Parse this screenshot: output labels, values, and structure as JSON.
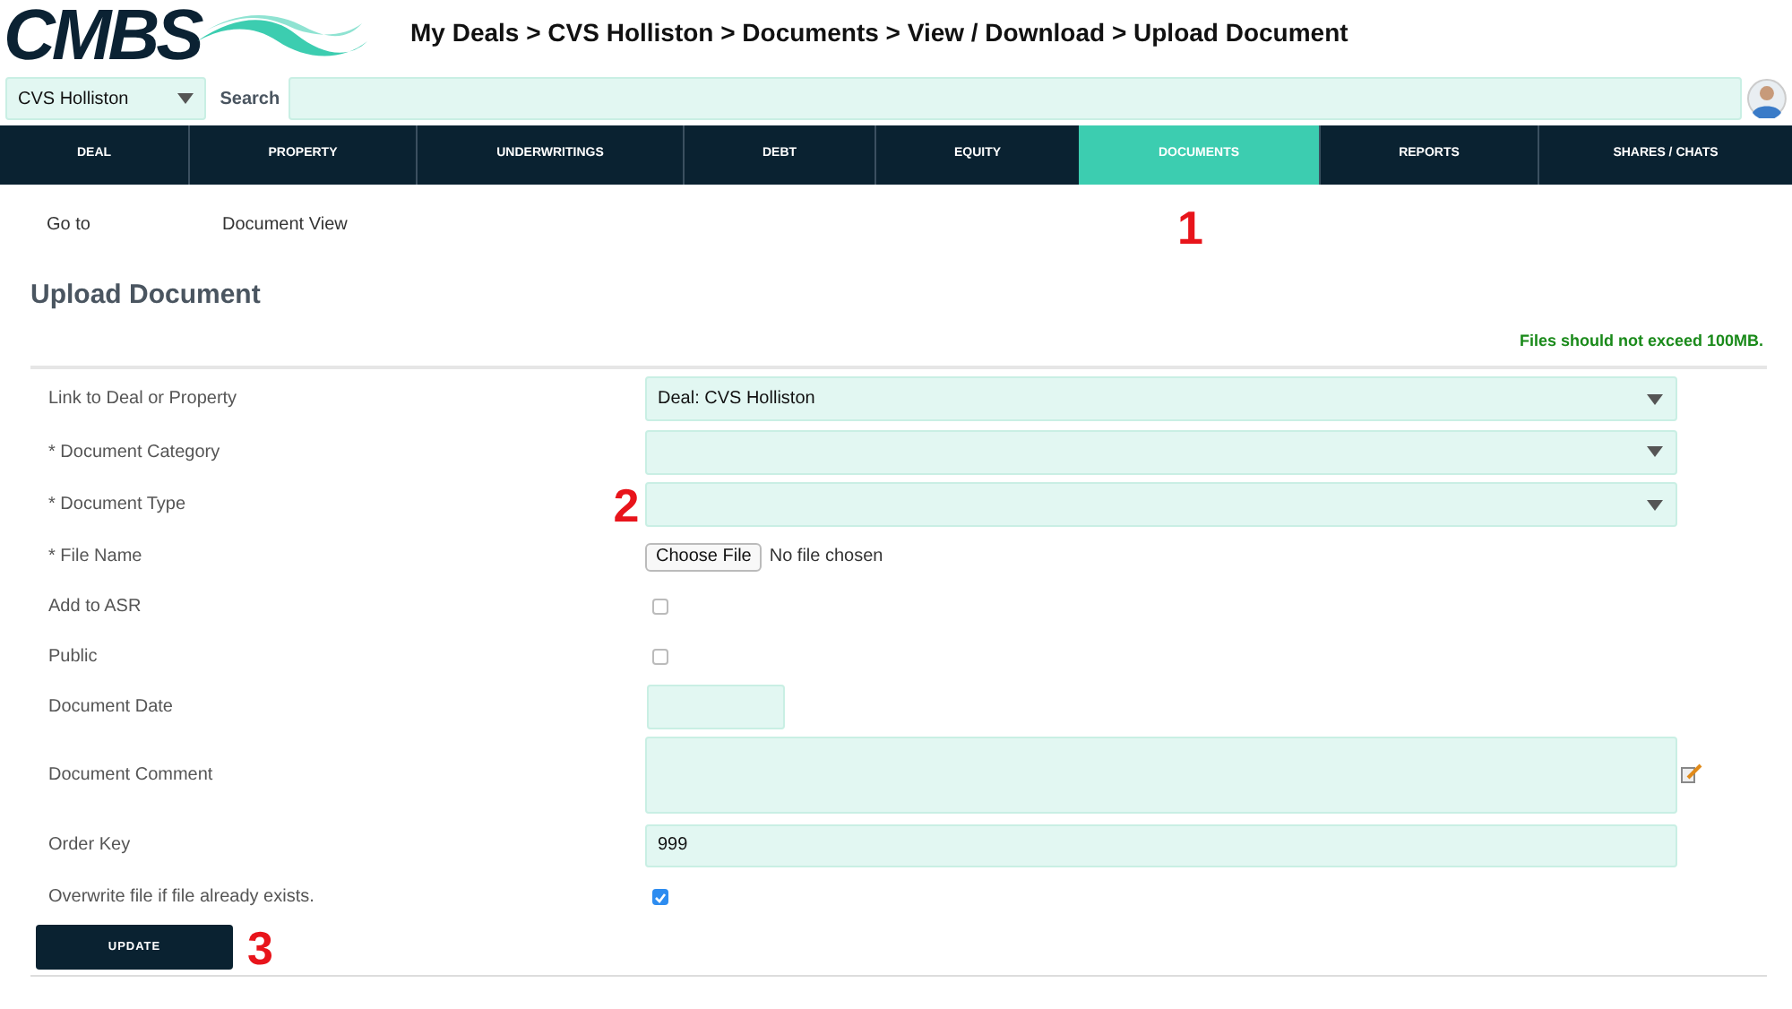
{
  "logo": {
    "text": "CMBS"
  },
  "breadcrumb": "My Deals > CVS Holliston > Documents > View / Download > Upload Document",
  "deal_select": {
    "value": "CVS Holliston"
  },
  "search": {
    "label": "Search"
  },
  "tabs": [
    {
      "label": "DEAL",
      "selected": false
    },
    {
      "label": "PROPERTY",
      "selected": false
    },
    {
      "label": "UNDERWRITINGS",
      "selected": false
    },
    {
      "label": "DEBT",
      "selected": false
    },
    {
      "label": "EQUITY",
      "selected": false
    },
    {
      "label": "DOCUMENTS",
      "selected": true,
      "annotation": "1"
    },
    {
      "label": "REPORTS",
      "selected": false
    },
    {
      "label": "SHARES / CHATS",
      "selected": false
    }
  ],
  "goto": {
    "label": "Go to",
    "value": "Document View"
  },
  "title": "Upload Document",
  "notice": "Files should not exceed 100MB.",
  "fields": [
    {
      "kind": "select",
      "label": "Link to Deal or Property",
      "value": "Deal: CVS Holliston"
    },
    {
      "kind": "select",
      "label": "* Document Category"
    },
    {
      "kind": "select",
      "label": "* Document Type",
      "annotation": "2"
    },
    {
      "kind": "file",
      "label": "* File Name",
      "button": "Choose File",
      "status": "No file chosen"
    },
    {
      "kind": "checkbox",
      "label": "Add to ASR",
      "checked": false
    },
    {
      "kind": "checkbox",
      "label": "Public",
      "checked": false
    },
    {
      "kind": "date",
      "label": "Document Date"
    },
    {
      "kind": "textarea",
      "label": "Document Comment"
    },
    {
      "kind": "text",
      "label": "Order Key",
      "value": "999"
    },
    {
      "kind": "checkbox",
      "label": "Overwrite file if file already exists.",
      "checked": true
    }
  ],
  "submit": {
    "label": "UPDATE",
    "annotation": "3"
  }
}
